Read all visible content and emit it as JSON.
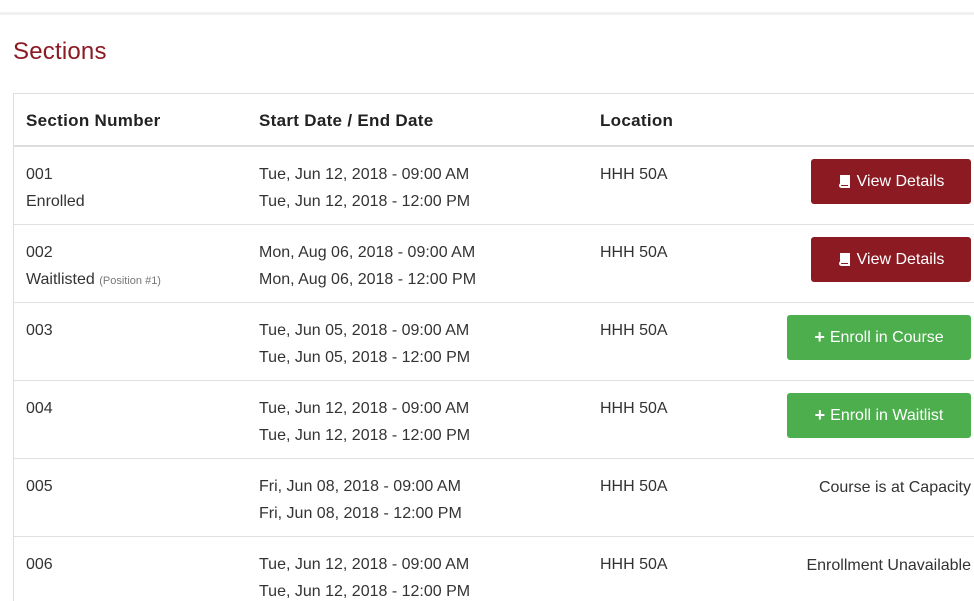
{
  "section_title": "Sections",
  "table": {
    "headers": {
      "section_number": "Section Number",
      "dates": "Start Date / End Date",
      "location": "Location"
    },
    "rows": [
      {
        "number": "001",
        "status": "Enrolled",
        "status_note": "",
        "start": "Tue, Jun 12, 2018 - 09:00 AM",
        "end": "Tue, Jun 12, 2018 - 12:00 PM",
        "location": "HHH 50A",
        "action_label": "View Details"
      },
      {
        "number": "002",
        "status": "Waitlisted",
        "status_note": "(Position #1)",
        "start": "Mon, Aug 06, 2018 - 09:00 AM",
        "end": "Mon, Aug 06, 2018 - 12:00 PM",
        "location": "HHH 50A",
        "action_label": "View Details"
      },
      {
        "number": "003",
        "status": "",
        "status_note": "",
        "start": "Tue, Jun 05, 2018 - 09:00 AM",
        "end": "Tue, Jun 05, 2018 - 12:00 PM",
        "location": "HHH 50A",
        "action_label": "Enroll in Course"
      },
      {
        "number": "004",
        "status": "",
        "status_note": "",
        "start": "Tue, Jun 12, 2018 - 09:00 AM",
        "end": "Tue, Jun 12, 2018 - 12:00 PM",
        "location": "HHH 50A",
        "action_label": "Enroll in Waitlist"
      },
      {
        "number": "005",
        "status": "",
        "status_note": "",
        "start": "Fri, Jun 08, 2018 - 09:00 AM",
        "end": "Fri, Jun 08, 2018 - 12:00 PM",
        "location": "HHH 50A",
        "action_label": "Course is at Capacity"
      },
      {
        "number": "006",
        "status": "",
        "status_note": "",
        "start": "Tue, Jun 12, 2018 - 09:00 AM",
        "end": "Tue, Jun 12, 2018 - 12:00 PM",
        "location": "HHH 50A",
        "action_label": "Enrollment Unavailable"
      }
    ]
  },
  "colors": {
    "brand": "#8b1a22",
    "success": "#4cae4c"
  },
  "icons": {
    "details": "book-icon",
    "enroll": "plus-icon"
  }
}
